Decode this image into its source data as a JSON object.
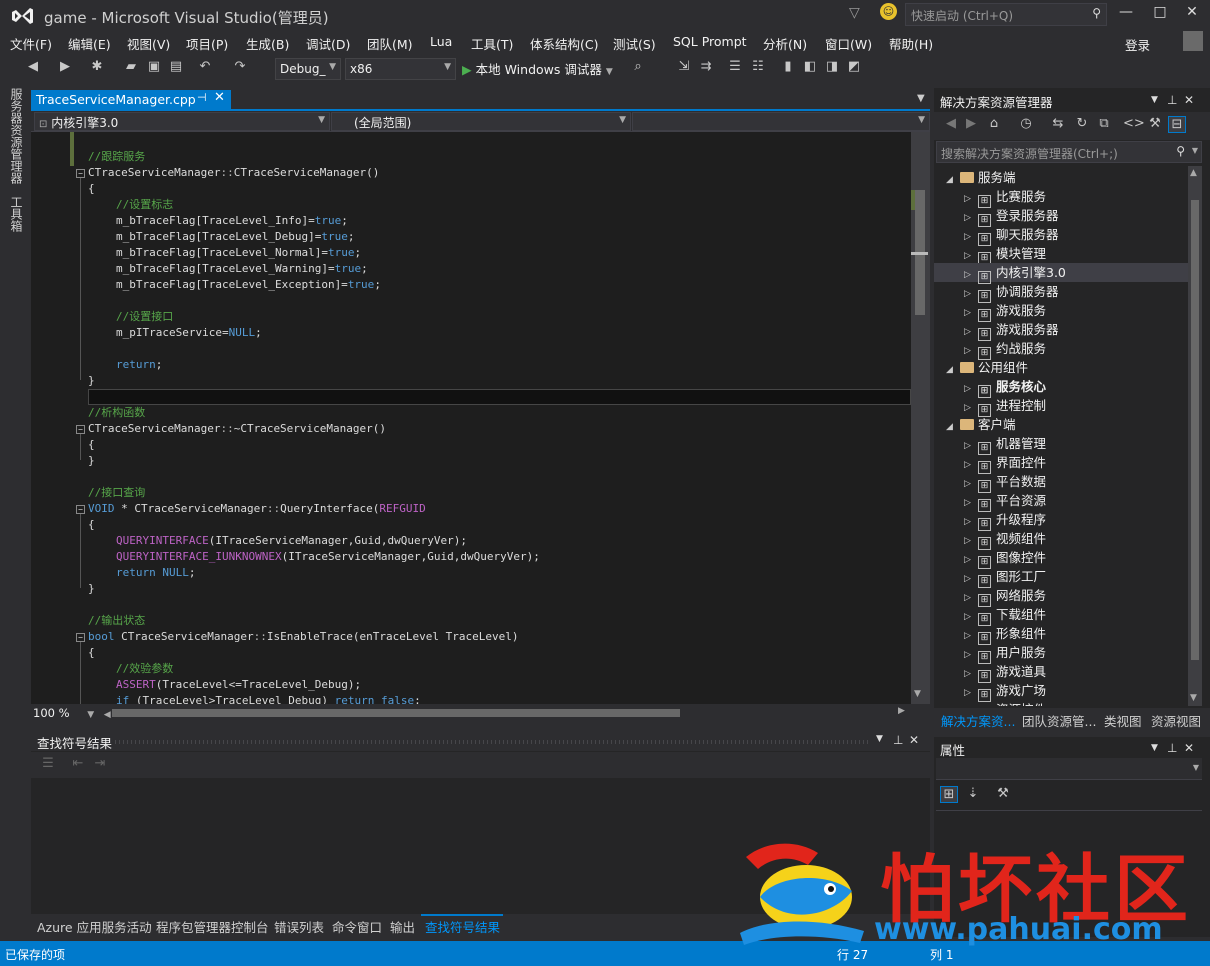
{
  "window": {
    "title": "game - Microsoft Visual Studio(管理员)",
    "quick_launch_placeholder": "快速启动 (Ctrl+Q)",
    "login_label": "登录"
  },
  "menu": [
    "文件(F)",
    "编辑(E)",
    "视图(V)",
    "项目(P)",
    "生成(B)",
    "调试(D)",
    "团队(M)",
    "Lua",
    "工具(T)",
    "体系结构(C)",
    "测试(S)",
    "SQL Prompt",
    "分析(N)",
    "窗口(W)",
    "帮助(H)"
  ],
  "toolbar": {
    "config": "Debug_",
    "platform": "x86",
    "run_label": "本地 Windows 调试器"
  },
  "side_tabs": [
    "服务器资源管理器",
    "工具箱"
  ],
  "editor": {
    "tab_name": "TraceServiceManager.cpp",
    "nav_left": "内核引擎3.0",
    "nav_right": "(全局范围)",
    "zoom": "100 %",
    "lines": [
      {
        "t": "cmt",
        "text": "//跟踪服务",
        "indent": 0
      },
      {
        "t": "code",
        "html": "CTraceServiceManager::CTraceServiceManager()"
      },
      {
        "t": "plain",
        "text": "{",
        "indent": 0
      },
      {
        "t": "cmt",
        "text": "//设置标志",
        "indent": 1
      },
      {
        "t": "plain",
        "text": "m_bTraceFlag[TraceLevel_Info]=true;",
        "indent": 1
      },
      {
        "t": "plain",
        "text": "m_bTraceFlag[TraceLevel_Debug]=true;",
        "indent": 1
      },
      {
        "t": "plain",
        "text": "m_bTraceFlag[TraceLevel_Normal]=true;",
        "indent": 1
      },
      {
        "t": "plain",
        "text": "m_bTraceFlag[TraceLevel_Warning]=true;",
        "indent": 1
      },
      {
        "t": "plain",
        "text": "m_bTraceFlag[TraceLevel_Exception]=true;",
        "indent": 1
      },
      {
        "t": "blank",
        "text": ""
      },
      {
        "t": "cmt",
        "text": "//设置接口",
        "indent": 1
      },
      {
        "t": "plain",
        "text": "m_pITraceService=NULL;",
        "indent": 1
      },
      {
        "t": "blank",
        "text": ""
      },
      {
        "t": "kwline",
        "text": "return;",
        "indent": 1
      },
      {
        "t": "plain",
        "text": "}",
        "indent": 0
      },
      {
        "t": "blank",
        "text": ""
      },
      {
        "t": "cmt",
        "text": "//析构函数",
        "indent": 0
      },
      {
        "t": "code",
        "html": "CTraceServiceManager::~CTraceServiceManager()"
      },
      {
        "t": "plain",
        "text": "{",
        "indent": 0
      },
      {
        "t": "plain",
        "text": "}",
        "indent": 0
      },
      {
        "t": "blank",
        "text": ""
      },
      {
        "t": "cmt",
        "text": "//接口查询",
        "indent": 0
      },
      {
        "t": "code",
        "html": "VOID * CTraceServiceManager::QueryInterface(REFGUID"
      },
      {
        "t": "plain",
        "text": "{",
        "indent": 0
      },
      {
        "t": "code",
        "html": "QUERYINTERFACE(ITraceServiceManager,Guid,dwQueryVer);",
        "indent": 1
      },
      {
        "t": "code",
        "html": "QUERYINTERFACE_IUNKNOWNEX(ITraceServiceManager,Guid,dwQueryVer);",
        "indent": 1
      },
      {
        "t": "kwline",
        "text": "return NULL;",
        "indent": 1
      },
      {
        "t": "plain",
        "text": "}",
        "indent": 0
      },
      {
        "t": "blank",
        "text": ""
      },
      {
        "t": "cmt",
        "text": "//输出状态",
        "indent": 0
      },
      {
        "t": "code",
        "html": "bool CTraceServiceManager::IsEnableTrace(enTraceLevel TraceLevel)"
      },
      {
        "t": "plain",
        "text": "{",
        "indent": 0
      },
      {
        "t": "cmt",
        "text": "//效验参数",
        "indent": 1
      },
      {
        "t": "code",
        "html": "ASSERT(TraceLevel<=TraceLevel_Debug);",
        "indent": 1
      },
      {
        "t": "code",
        "html": "if (TraceLevel>TraceLevel_Debug) return false;",
        "indent": 1
      }
    ]
  },
  "find_panel": {
    "title": "查找符号结果"
  },
  "bottom_tabs": [
    "Azure 应用服务活动",
    "程序包管理器控制台",
    "错误列表",
    "命令窗口",
    "输出",
    "查找符号结果"
  ],
  "solution_explorer": {
    "title": "解决方案资源管理器",
    "search_placeholder": "搜索解决方案资源管理器(Ctrl+;)",
    "tree": [
      {
        "label": "服务端",
        "level": 0,
        "folder": true,
        "expanded": true
      },
      {
        "label": "比赛服务",
        "level": 1
      },
      {
        "label": "登录服务器",
        "level": 1
      },
      {
        "label": "聊天服务器",
        "level": 1
      },
      {
        "label": "模块管理",
        "level": 1
      },
      {
        "label": "内核引擎3.0",
        "level": 1,
        "selected": true
      },
      {
        "label": "协调服务器",
        "level": 1
      },
      {
        "label": "游戏服务",
        "level": 1
      },
      {
        "label": "游戏服务器",
        "level": 1
      },
      {
        "label": "约战服务",
        "level": 1
      },
      {
        "label": "公用组件",
        "level": 0,
        "folder": true,
        "expanded": true
      },
      {
        "label": "服务核心",
        "level": 1,
        "bold": true
      },
      {
        "label": "进程控制",
        "level": 1
      },
      {
        "label": "客户端",
        "level": 0,
        "folder": true,
        "expanded": true
      },
      {
        "label": "机器管理",
        "level": 1
      },
      {
        "label": "界面控件",
        "level": 1
      },
      {
        "label": "平台数据",
        "level": 1
      },
      {
        "label": "平台资源",
        "level": 1
      },
      {
        "label": "升级程序",
        "level": 1
      },
      {
        "label": "视频组件",
        "level": 1
      },
      {
        "label": "图像控件",
        "level": 1
      },
      {
        "label": "图形工厂",
        "level": 1
      },
      {
        "label": "网络服务",
        "level": 1
      },
      {
        "label": "下载组件",
        "level": 1
      },
      {
        "label": "形象组件",
        "level": 1
      },
      {
        "label": "用户服务",
        "level": 1
      },
      {
        "label": "游戏道具",
        "level": 1
      },
      {
        "label": "游戏广场",
        "level": 1
      },
      {
        "label": "资源控件",
        "level": 1
      }
    ],
    "tabs": [
      "解决方案资...",
      "团队资源管...",
      "类视图",
      "资源视图"
    ]
  },
  "properties": {
    "title": "属性"
  },
  "status": {
    "left": "已保存的项",
    "line": "行 27",
    "col": "列 1"
  },
  "watermark": {
    "title": "怕坏社区",
    "url": "www.pahuai.com"
  },
  "colors": {
    "accent": "#007acc",
    "comment": "#57a64a",
    "keyword": "#569cd6",
    "macro": "#bd63c5",
    "watermark_red": "#e1251b",
    "watermark_blue": "#1e8fe1"
  }
}
